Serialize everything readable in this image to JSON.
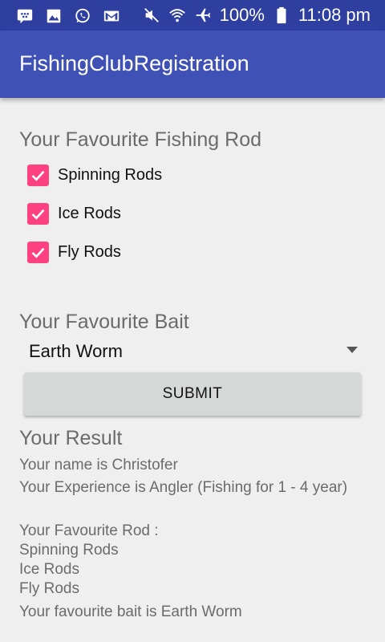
{
  "status_bar": {
    "icons": [
      "bbm-icon",
      "image-icon",
      "whatsapp-icon",
      "gmail-icon",
      "mute-icon",
      "wifi-icon",
      "airplane-icon",
      "battery-icon"
    ],
    "battery": "100%",
    "time": "11:08 pm"
  },
  "app_bar": {
    "title": "FishingClubRegistration"
  },
  "rods": {
    "heading": "Your Favourite Fishing Rod",
    "options": [
      {
        "label": "Spinning Rods",
        "checked": true
      },
      {
        "label": "Ice Rods",
        "checked": true
      },
      {
        "label": "Fly Rods",
        "checked": true
      }
    ]
  },
  "bait": {
    "heading": "Your Favourite Bait",
    "selected": "Earth Worm"
  },
  "submit": {
    "label": "SUBMIT"
  },
  "result": {
    "heading": "Your Result",
    "name_line": "Your name is Christofer",
    "experience_line": "Your Experience is Angler (Fishing for 1 - 4 year)",
    "rod_heading": "Your Favourite Rod :",
    "rods": [
      "Spinning Rods",
      "Ice Rods",
      "Fly Rods"
    ],
    "bait_line": "Your favourite bait is Earth Worm"
  },
  "colors": {
    "status_bar": "#2f3fa0",
    "app_bar": "#3f51b5",
    "accent": "#ff4081",
    "background": "#efefef",
    "button": "#d6d7d7"
  }
}
